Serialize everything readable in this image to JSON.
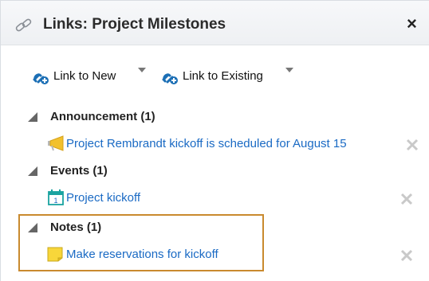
{
  "header": {
    "title": "Links: Project Milestones",
    "close_label": "×"
  },
  "toolbar": {
    "link_new_label": "Link to New",
    "link_existing_label": "Link to Existing"
  },
  "sections": [
    {
      "label": "Announcement (1)",
      "item": "Project Rembrandt kickoff is scheduled for August 15"
    },
    {
      "label": "Events (1)",
      "item": "Project kickoff",
      "calendar_day": "1"
    },
    {
      "label": "Notes (1)",
      "item": "Make reservations for kickoff"
    }
  ],
  "icons": {
    "header": "link-icon",
    "toolbar": "add-link-icon",
    "announcement": "megaphone-icon",
    "event": "calendar-icon",
    "note": "note-icon",
    "delete": "remove-x-icon"
  },
  "colors": {
    "link": "#1a6ac4",
    "accent_blue": "#1c6fb5",
    "highlight_border": "#c98a2e",
    "delete_gray": "#c9c9c9"
  }
}
